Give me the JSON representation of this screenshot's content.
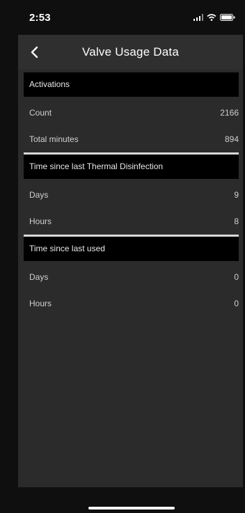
{
  "status_bar": {
    "time": "2:53"
  },
  "nav": {
    "title": "Valve Usage Data",
    "back_icon": "chevron-left-icon"
  },
  "sections": {
    "activations": {
      "title": "Activations",
      "rows": [
        {
          "label": "Count",
          "value": "2166"
        },
        {
          "label": "Total minutes",
          "value": "894"
        }
      ]
    },
    "thermal": {
      "title": "Time since last Thermal Disinfection",
      "rows": [
        {
          "label": "Days",
          "value": "9"
        },
        {
          "label": "Hours",
          "value": "8"
        }
      ]
    },
    "last_used": {
      "title": "Time since last used",
      "rows": [
        {
          "label": "Days",
          "value": "0"
        },
        {
          "label": "Hours",
          "value": "0"
        }
      ]
    }
  },
  "colors": {
    "background": "#0f0f0f",
    "panel": "#2b2b2b",
    "header": "#000000",
    "divider": "#d9d9d9"
  }
}
